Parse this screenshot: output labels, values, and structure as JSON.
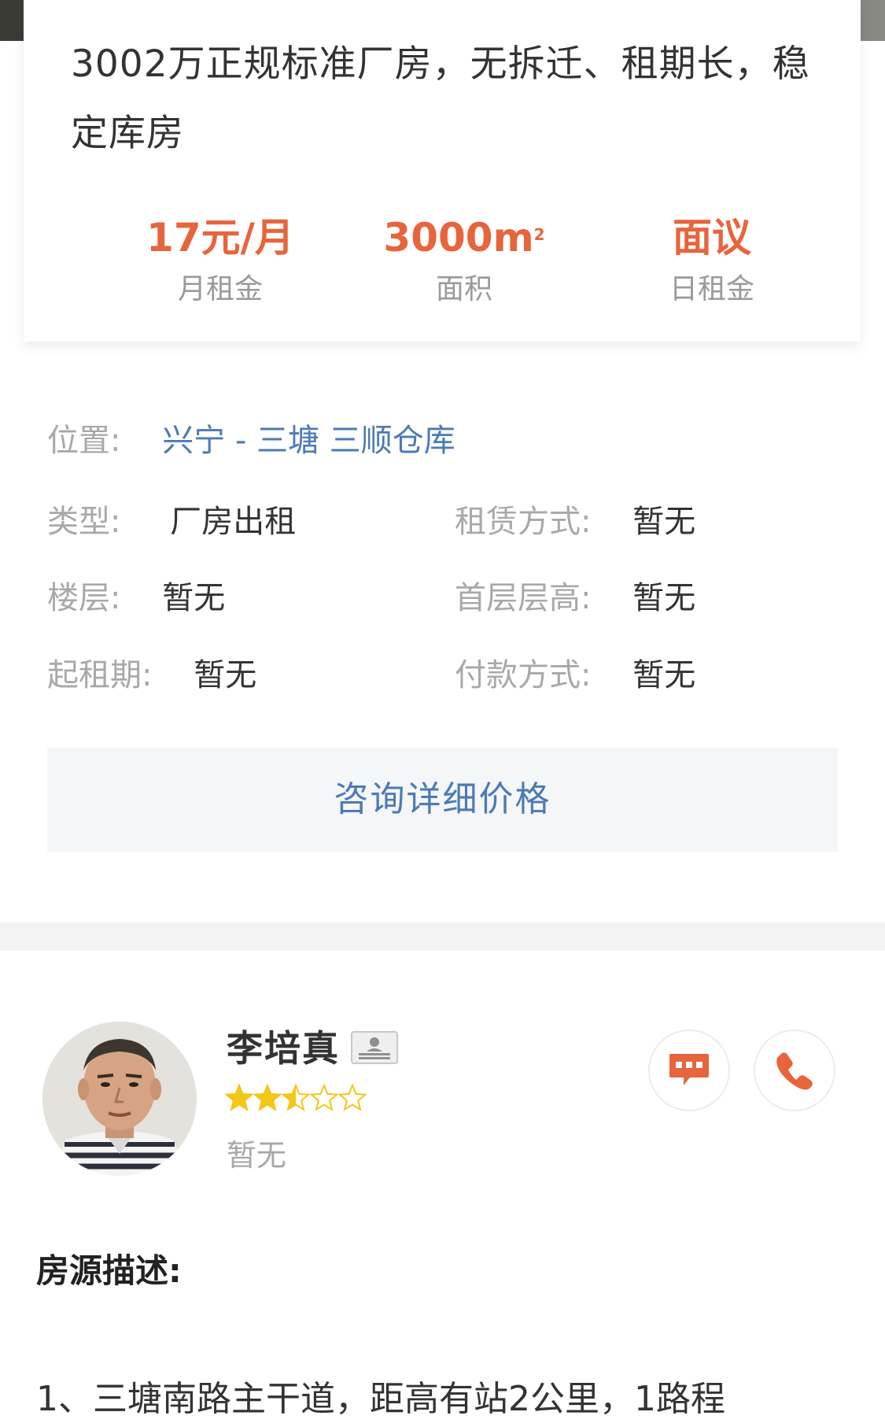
{
  "listing": {
    "title": "3002万正规标准厂房，无拆迁、租期长，稳定库房",
    "stats": {
      "monthly_rent": {
        "value": "17元/月",
        "label": "月租金"
      },
      "area": {
        "value": "3000m",
        "unit_sup": "2",
        "label": "面积"
      },
      "daily_rent": {
        "value": "面议",
        "label": "日租金"
      }
    }
  },
  "details": {
    "location": {
      "key": "位置:",
      "value": "兴宁 - 三塘 三顺仓库"
    },
    "type": {
      "key": "类型:",
      "value": "厂房出租"
    },
    "lease_method": {
      "key": "租赁方式:",
      "value": "暂无"
    },
    "floor": {
      "key": "楼层:",
      "value": "暂无"
    },
    "first_floor_height": {
      "key": "首层层高:",
      "value": "暂无"
    },
    "min_lease": {
      "key": "起租期:",
      "value": "暂无"
    },
    "payment": {
      "key": "付款方式:",
      "value": "暂无"
    }
  },
  "consult_button": {
    "label": "咨询详细价格"
  },
  "agent": {
    "name": "李培真",
    "rating": 2.5,
    "rating_max": 5,
    "subtitle": "暂无",
    "actions": {
      "chat_icon": "chat-icon",
      "phone_icon": "phone-icon"
    }
  },
  "description": {
    "heading": "房源描述:",
    "first_line": "1、三塘南路主干道，距高有站2公里，1路程"
  },
  "colors": {
    "accent": "#e8643c",
    "link": "#4b7bb5",
    "muted": "#a8a8a8",
    "star": "#f5c518"
  }
}
